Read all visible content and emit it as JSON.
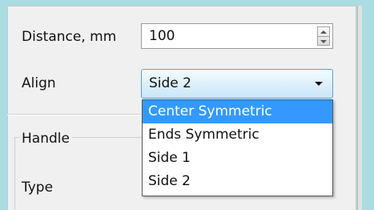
{
  "form": {
    "distance_label": "Distance, mm",
    "distance_value": "100",
    "align_label": "Align",
    "align_value": "Side 2"
  },
  "handle_group": {
    "title": "Handle",
    "type_label": "Type"
  },
  "dropdown": {
    "options": [
      "Center Symmetric",
      "Ends Symmetric",
      "Side 1",
      "Side 2"
    ],
    "highlighted_index": 0
  },
  "colors": {
    "background": "#a9dde2",
    "highlight": "#3399ff",
    "panel": "#f0f0f0"
  }
}
